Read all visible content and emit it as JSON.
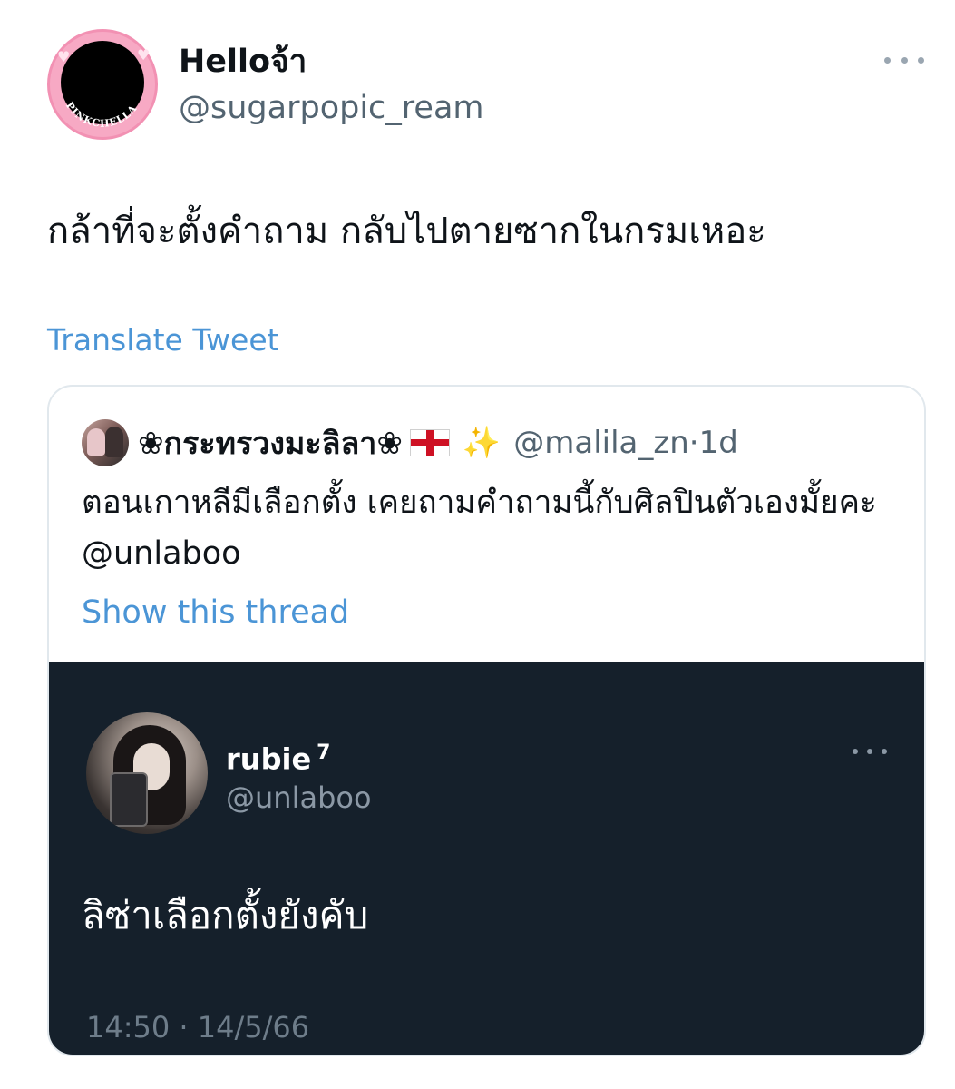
{
  "tweet": {
    "author_name": "Helloจ้า",
    "author_handle": "@sugarpopic_ream",
    "avatar_ring_text": "PINKCHELLA",
    "text": "กล้าที่จะตั้งคำถาม กลับไปตายซากในกรมเหอะ",
    "translate_label": "Translate Tweet",
    "more_icon": "more-horizontal-icon"
  },
  "quoted_tweet": {
    "author_name": "❀กระทรวงมะลิลา❀",
    "flag_icon": "england-flag-icon",
    "sparkle": "✨",
    "author_handle": "@malila_zn",
    "separator": "·",
    "time_ago": "1d",
    "text": "ตอนเกาหลีมีเลือกตั้ง เคยถามคำถามนี้กับศิลปินตัวเองมั้ยคะ @unlaboo",
    "show_thread_label": "Show this thread"
  },
  "embedded_screenshot": {
    "author_name": "rubie",
    "author_name_superscript": "7",
    "author_handle": "@unlaboo",
    "text": "ลิซ่าเลือกตั้งยังคับ",
    "timestamp": "14:50 · 14/5/66",
    "more_icon": "more-horizontal-icon"
  },
  "colors": {
    "link": "#4b95d6",
    "secondary_text": "#536471",
    "dark_background": "#15202b",
    "dark_secondary_text": "#8b98a5"
  }
}
